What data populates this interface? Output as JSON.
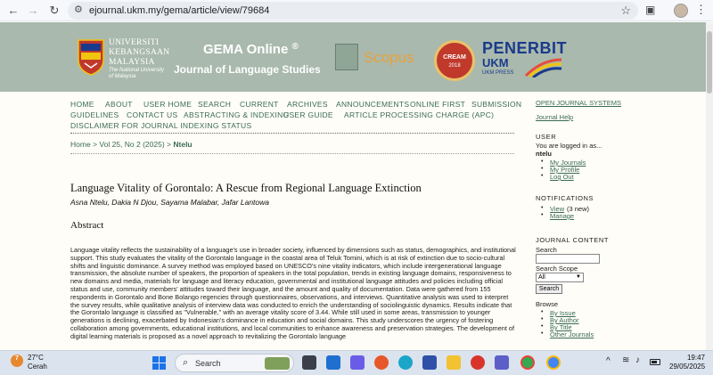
{
  "browser": {
    "url": "ejournal.ukm.my/gema/article/view/79684"
  },
  "banner": {
    "ukm_name_lines": [
      "UNIVERSITI",
      "KEBANGSAAN",
      "MALAYSIA"
    ],
    "ukm_tagline_lines": [
      "The National University",
      "of Malaysia"
    ],
    "gema_title": "GEMA Online",
    "gema_reg": "®",
    "gema_subtitle": "Journal of Language Studies",
    "scopus": "Scopus",
    "cream": "CREAM",
    "cream_year": "2018",
    "penerbit": "PENERBIT",
    "penerbit_ukm": "UKM",
    "ukm_press": "UKM PRESS",
    "colors": {
      "banner": "#a9b9ad",
      "cream_red": "#c0392b",
      "penerbit_blue": "#1a3a8c",
      "scopus_orange": "#e9a23b"
    }
  },
  "nav": {
    "items": [
      "HOME",
      "ABOUT",
      "USER HOME",
      "SEARCH",
      "CURRENT",
      "ARCHIVES",
      "ANNOUNCEMENTS",
      "ONLINE FIRST",
      "SUBMISSION",
      "GUIDELINES",
      "CONTACT US",
      "ABSTRACTING & INDEXING",
      "USER GUIDE",
      "ARTICLE PROCESSING CHARGE (APC)",
      "DISCLAIMER FOR JOURNAL INDEXING STATUS"
    ],
    "link_color": "#3a6b57"
  },
  "breadcrumb": {
    "home": "Home",
    "sep": ">",
    "issue": "Vol 25, No 2 (2025)",
    "current": "Ntelu"
  },
  "article": {
    "title": "Language Vitality of Gorontalo: A Rescue from Regional Language Extinction",
    "authors": "Asna Ntelu, Dakia N Djou, Sayama Malabar, Jafar Lantowa",
    "abstract_heading": "Abstract",
    "abstract": "Language vitality reflects the sustainability of a language's use in broader society, influenced by dimensions such as status, demographics, and institutional support. This study evaluates the vitality of the Gorontalo language in the coastal area of Teluk Tomini, which is at risk of extinction due to socio-cultural shifts and linguistic dominance.  A survey method was employed based on UNESCO's nine vitality indicators, which include intergenerational language transmission, the absolute number of speakers, the proportion of speakers in the total population, trends in existing language domains, responsiveness to new domains and media, materials for language and literacy education, governmental and institutional language attitudes and policies including official status and use, community members' attitudes toward their language, and the amount and quality of documentation. Data were gathered from 155 respondents in Gorontalo and Bone Bolango regencies through questionnaires, observations, and interviews. Quantitative analysis was used to interpret the survey results, while qualitative analysis of interview data was conducted to enrich the understanding of sociolinguistic dynamics. Results indicate that the Gorontalo language is classified as \"Vulnerable,\" with an average vitality score of 3.44. While still used in some areas, transmission to younger generations is declining, exacerbated by Indonesian's dominance in education and social domains. This study underscores the urgency of fostering collaboration among governments, educational institutions, and local communities to enhance awareness and preservation strategies. The development of digital learning materials is proposed as a novel approach to revitalizing the Gorontalo language"
  },
  "sidebar": {
    "open_journal_systems": "OPEN JOURNAL SYSTEMS",
    "journal_help": "Journal Help",
    "user_heading": "USER",
    "logged_in_as": "You are logged in as...",
    "username": "ntelu",
    "user_links": [
      "My Journals",
      "My Profile",
      "Log Out"
    ],
    "notifications_heading": "NOTIFICATIONS",
    "notif_view": "View",
    "notif_count": "(3 new)",
    "notif_manage": "Manage",
    "journal_content_heading": "JOURNAL CONTENT",
    "search_label": "Search",
    "search_scope_label": "Search Scope",
    "search_scope_value": "All",
    "search_button": "Search",
    "browse_label": "Browse",
    "browse_links": [
      "By Issue",
      "By Author",
      "By Title",
      "Other Journals"
    ]
  },
  "taskbar": {
    "weather_badge": "7",
    "temperature": "27°C",
    "condition": "Cerah",
    "search_placeholder": "Search",
    "time": "19:47",
    "date": "29/05/2025"
  }
}
